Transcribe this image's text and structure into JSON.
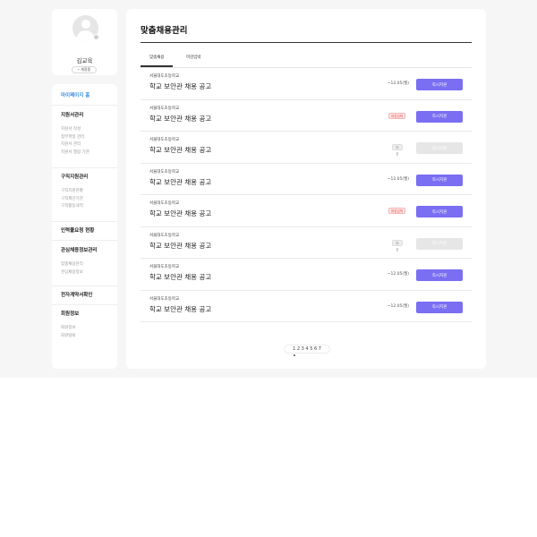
{
  "profile": {
    "name": "김교육",
    "button_label": "+ 계정중"
  },
  "sidebar": {
    "home": "마이페이지 홈",
    "sections": [
      {
        "title": "지원서관리",
        "items": [
          "지원서 작성",
          "첨부파일 관리",
          "지원서 관리",
          "지원서 열람 기관"
        ]
      },
      {
        "title": "구직지원관리",
        "items": [
          "구직지원현황",
          "구직제안기관",
          "구직활동내역"
        ]
      },
      {
        "title": "인력풀요청 현황",
        "items": []
      },
      {
        "title": "관심채용정보관리",
        "items": [
          "맞춤채용관리",
          "관심채용정보"
        ]
      },
      {
        "title": "전자계약서확인",
        "items": []
      },
      {
        "title": "회원정보",
        "items": [
          "회원정보",
          "회원탈퇴"
        ]
      }
    ]
  },
  "main": {
    "title": "맞춤채용관리",
    "tabs": [
      "맞춤채용",
      "마감임박"
    ],
    "jobs": [
      {
        "school": "서울대도초등학교",
        "title": "학교 보안관 채용 공고",
        "deadline": "~12.05(월)",
        "badge": "",
        "button": "즉시지원"
      },
      {
        "school": "서울대도초등학교",
        "title": "학교 보안관 채용 공고",
        "deadline": "",
        "badge": "마감임박",
        "button": "즉시지원"
      },
      {
        "school": "서울대도초등학교",
        "title": "학교 보안관 채용 공고",
        "deadline": "",
        "badge": "마감",
        "button": "즉시지원"
      },
      {
        "school": "서울대도초등학교",
        "title": "학교 보안관 채용 공고",
        "deadline": "~12.05(월)",
        "badge": "",
        "button": "즉시지원"
      },
      {
        "school": "서울대도초등학교",
        "title": "학교 보안관 채용 공고",
        "deadline": "",
        "badge": "마감임박",
        "button": "즉시지원"
      },
      {
        "school": "서울대도초등학교",
        "title": "학교 보안관 채용 공고",
        "deadline": "",
        "badge": "마감",
        "button": "즉시지원"
      },
      {
        "school": "서울대도초등학교",
        "title": "학교 보안관 채용 공고",
        "deadline": "~12.05(월)",
        "badge": "",
        "button": "즉시지원"
      },
      {
        "school": "서울대도초등학교",
        "title": "학교 보안관 채용 공고",
        "deadline": "~12.05(월)",
        "badge": "",
        "button": "즉시지원"
      }
    ],
    "pagination": {
      "pages": [
        "1",
        "2",
        "3",
        "4",
        "5",
        "6",
        "7"
      ],
      "current": "1"
    }
  },
  "colors": {
    "accent": "#7a6ef2",
    "home_link": "#3d8ee0",
    "urgent": "#e04848",
    "disabled": "#e6e6e6"
  }
}
